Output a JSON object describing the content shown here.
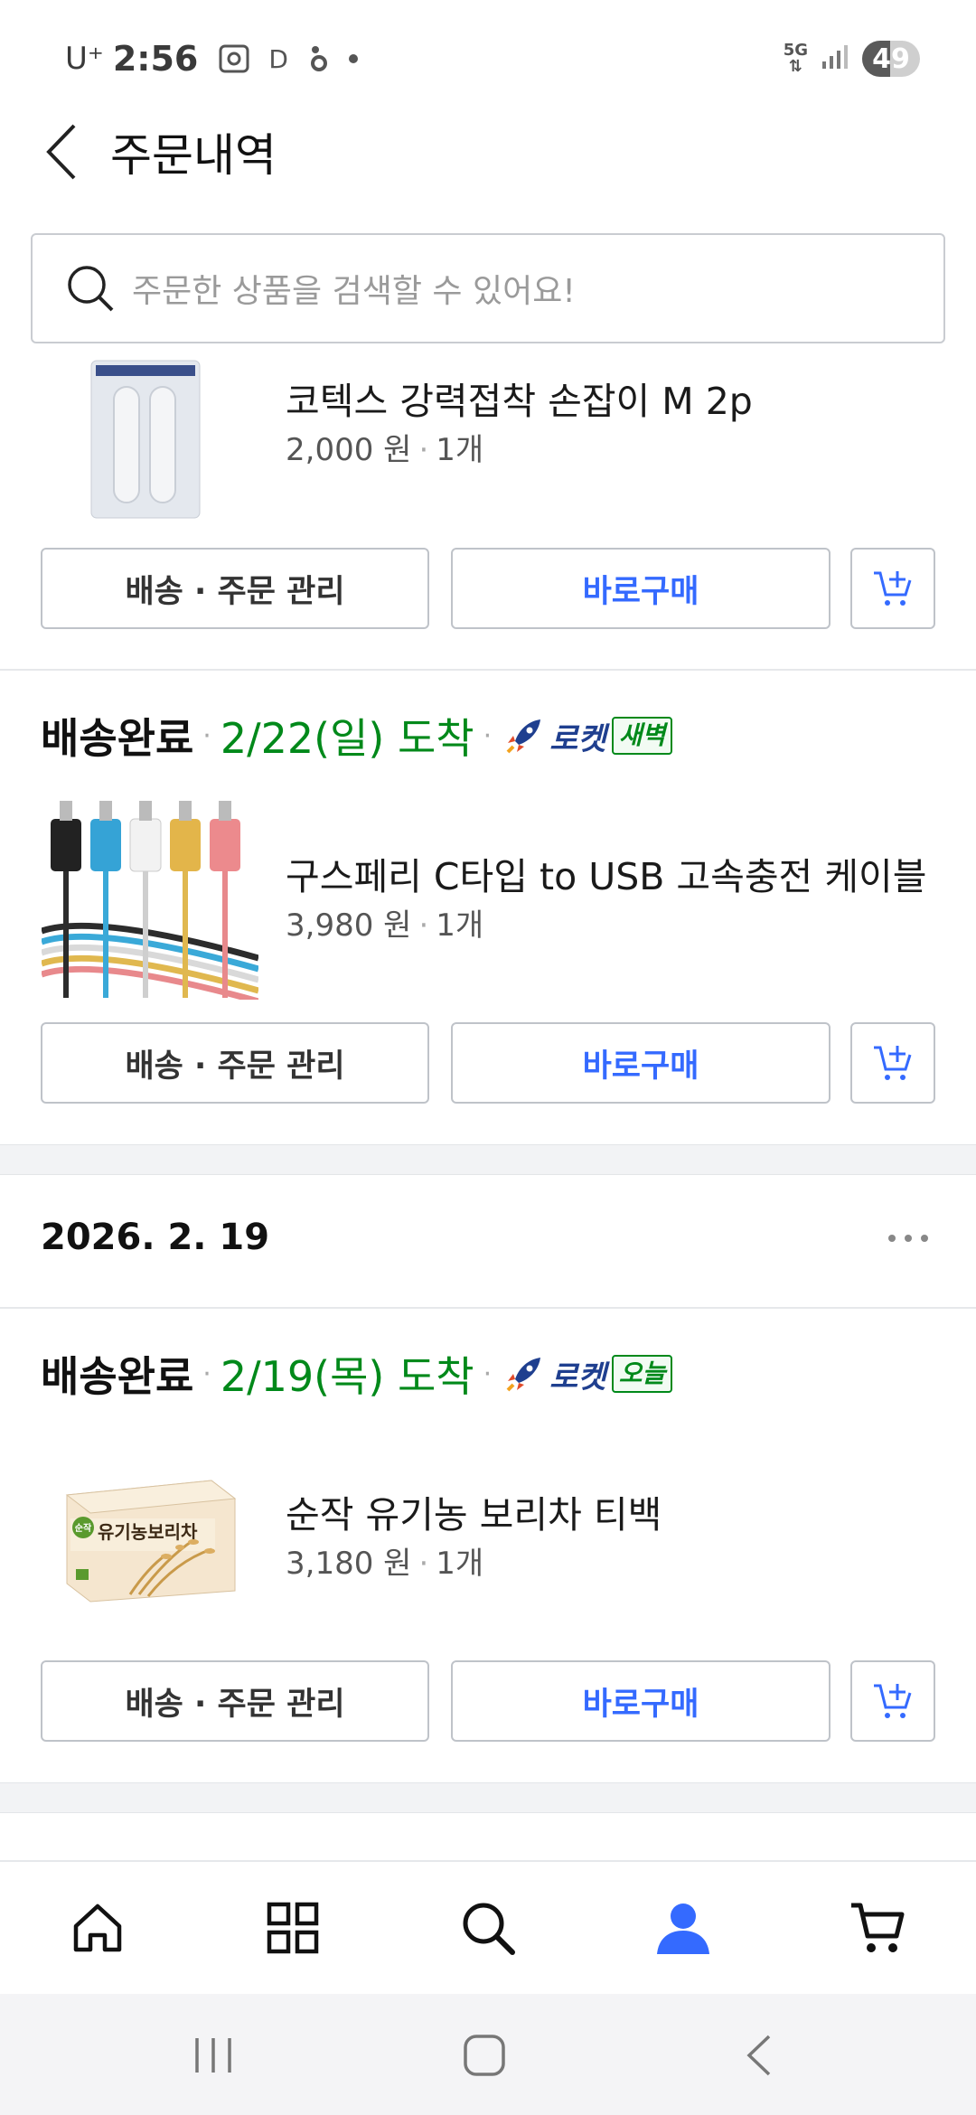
{
  "status_bar": {
    "carrier": "U⁺",
    "time": "2:56",
    "d_indicator": "D",
    "network": "5G",
    "battery_level": 49,
    "battery_text": "49"
  },
  "header": {
    "title": "주문내역",
    "back_icon": "chevron-left-icon"
  },
  "search": {
    "placeholder": "주문한 상품을 검색할 수 있어요!",
    "icon": "search-icon"
  },
  "orders": [
    {
      "items": [
        {
          "name": "코텍스 강력접착 손잡이 M 2p",
          "price": "2,000 원",
          "qty": "1개",
          "manage_label": "배송 · 주문 관리",
          "buy_label": "바로구매"
        }
      ]
    },
    {
      "status": "배송완료",
      "arrival": "2/22(일) 도착",
      "rocket_label": "로켓",
      "rocket_badge": "새벽",
      "items": [
        {
          "name": "구스페리 C타입 to USB 고속충전 케이블",
          "price": "3,980 원",
          "qty": "1개",
          "manage_label": "배송 · 주문 관리",
          "buy_label": "바로구매"
        }
      ]
    },
    {
      "date": "2026. 2. 19",
      "status": "배송완료",
      "arrival": "2/19(목) 도착",
      "rocket_label": "로켓",
      "rocket_badge": "오늘",
      "items": [
        {
          "name": "순작 유기농 보리차 티백",
          "price": "3,180 원",
          "qty": "1개",
          "manage_label": "배송 · 주문 관리",
          "buy_label": "바로구매",
          "package_text": "유기농보리차",
          "package_logo": "순작"
        }
      ]
    }
  ],
  "bottom_nav": [
    {
      "icon": "home-icon"
    },
    {
      "icon": "category-grid-icon"
    },
    {
      "icon": "search-icon"
    },
    {
      "icon": "my-account-icon",
      "active": true
    },
    {
      "icon": "cart-icon"
    }
  ],
  "colors": {
    "accent_blue": "#346aff",
    "arrival_green": "#00891a",
    "rocket_navy": "#1f3f8f"
  }
}
